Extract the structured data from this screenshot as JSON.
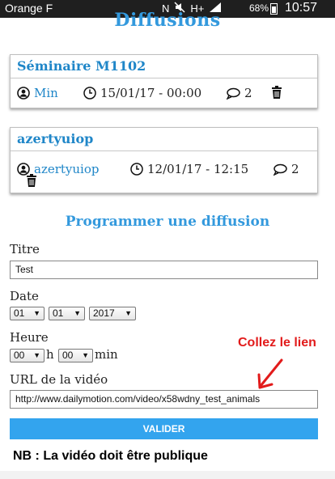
{
  "status_bar": {
    "carrier": "Orange F",
    "network": "H+",
    "battery": "68%",
    "time": "10:57",
    "icons": [
      "nfc-icon",
      "mute-icon",
      "network-type-icon",
      "signal-icon",
      "battery-icon"
    ]
  },
  "page": {
    "title": "Diffusions",
    "accent_color": "#3399dd",
    "link_color": "#1f86c8"
  },
  "broadcasts": [
    {
      "title": "Séminaire M1102",
      "user": "Min",
      "datetime": "15/01/17 - 00:00",
      "comments": "2"
    },
    {
      "title": "azertyuiop",
      "user": "azertyuiop",
      "datetime": "12/01/17 - 12:15",
      "comments": "2"
    }
  ],
  "form": {
    "heading": "Programmer une diffusion",
    "title_label": "Titre",
    "title_value": "Test",
    "date_label": "Date",
    "date_day": "01",
    "date_month": "01",
    "date_year": "2017",
    "time_label": "Heure",
    "time_hour": "00",
    "hour_unit": "h",
    "time_minute": "00",
    "minute_unit": "min",
    "url_label": "URL de la vidéo",
    "url_value": "http://www.dailymotion.com/video/x58wdny_test_animals",
    "submit_label": "VALIDER",
    "submit_color": "#33a4ee"
  },
  "annotations": {
    "paste_hint": "Collez le lien",
    "paste_hint_color": "#e21b1b",
    "note": "NB : La vidéo doit être publique"
  }
}
